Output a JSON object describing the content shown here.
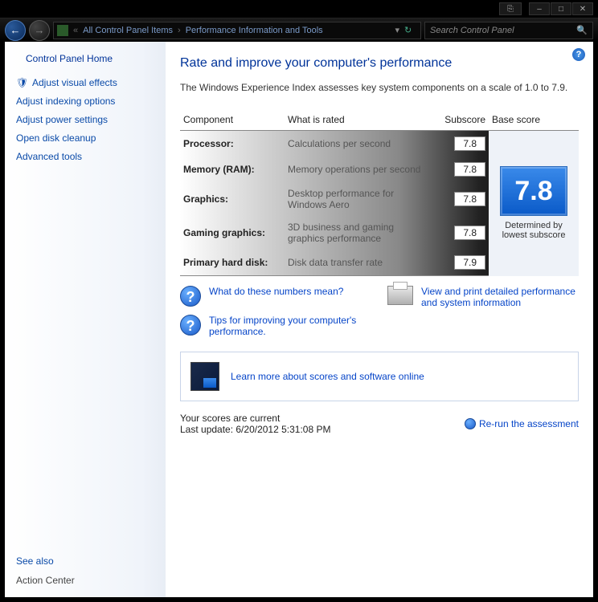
{
  "titlebar": {
    "min": "–",
    "max": "□",
    "close": "✕",
    "extra": "⎘"
  },
  "nav": {
    "back": "←",
    "fwd": "→",
    "drop": "▾",
    "refresh": "↻"
  },
  "breadcrumb": {
    "item1": "All Control Panel Items",
    "item2": "Performance Information and Tools",
    "sep": "«"
  },
  "search": {
    "placeholder": "Search Control Panel",
    "icon": "🔍"
  },
  "help": {
    "glyph": "?"
  },
  "sidebar": {
    "home": "Control Panel Home",
    "items": [
      {
        "label": "Adjust visual effects",
        "icon": "🛡"
      },
      {
        "label": "Adjust indexing options",
        "icon": ""
      },
      {
        "label": "Adjust power settings",
        "icon": ""
      },
      {
        "label": "Open disk cleanup",
        "icon": ""
      },
      {
        "label": "Advanced tools",
        "icon": ""
      }
    ],
    "see_also": "See also",
    "action_center": "Action Center"
  },
  "main": {
    "title": "Rate and improve your computer's performance",
    "subtitle": "The Windows Experience Index assesses key system components on a scale of 1.0 to 7.9.",
    "headers": {
      "component": "Component",
      "rated": "What is rated",
      "subscore": "Subscore",
      "base": "Base score"
    },
    "rows": [
      {
        "component": "Processor:",
        "desc": "Calculations per second",
        "sub": "7.8"
      },
      {
        "component": "Memory (RAM):",
        "desc": "Memory operations per second",
        "sub": "7.8"
      },
      {
        "component": "Graphics:",
        "desc": "Desktop performance for Windows Aero",
        "sub": "7.8"
      },
      {
        "component": "Gaming graphics:",
        "desc": "3D business and gaming graphics performance",
        "sub": "7.8"
      },
      {
        "component": "Primary hard disk:",
        "desc": "Disk data transfer rate",
        "sub": "7.9"
      }
    ],
    "base_score": "7.8",
    "base_label": "Determined by lowest subscore",
    "links": {
      "mean": "What do these numbers mean?",
      "tips": "Tips for improving your computer's performance.",
      "print": "View and print detailed performance and system information",
      "learn": "Learn more about scores and software online"
    },
    "status": {
      "current": "Your scores are current",
      "update": "Last update: 6/20/2012 5:31:08 PM",
      "rerun": "Re-run the assessment"
    }
  }
}
